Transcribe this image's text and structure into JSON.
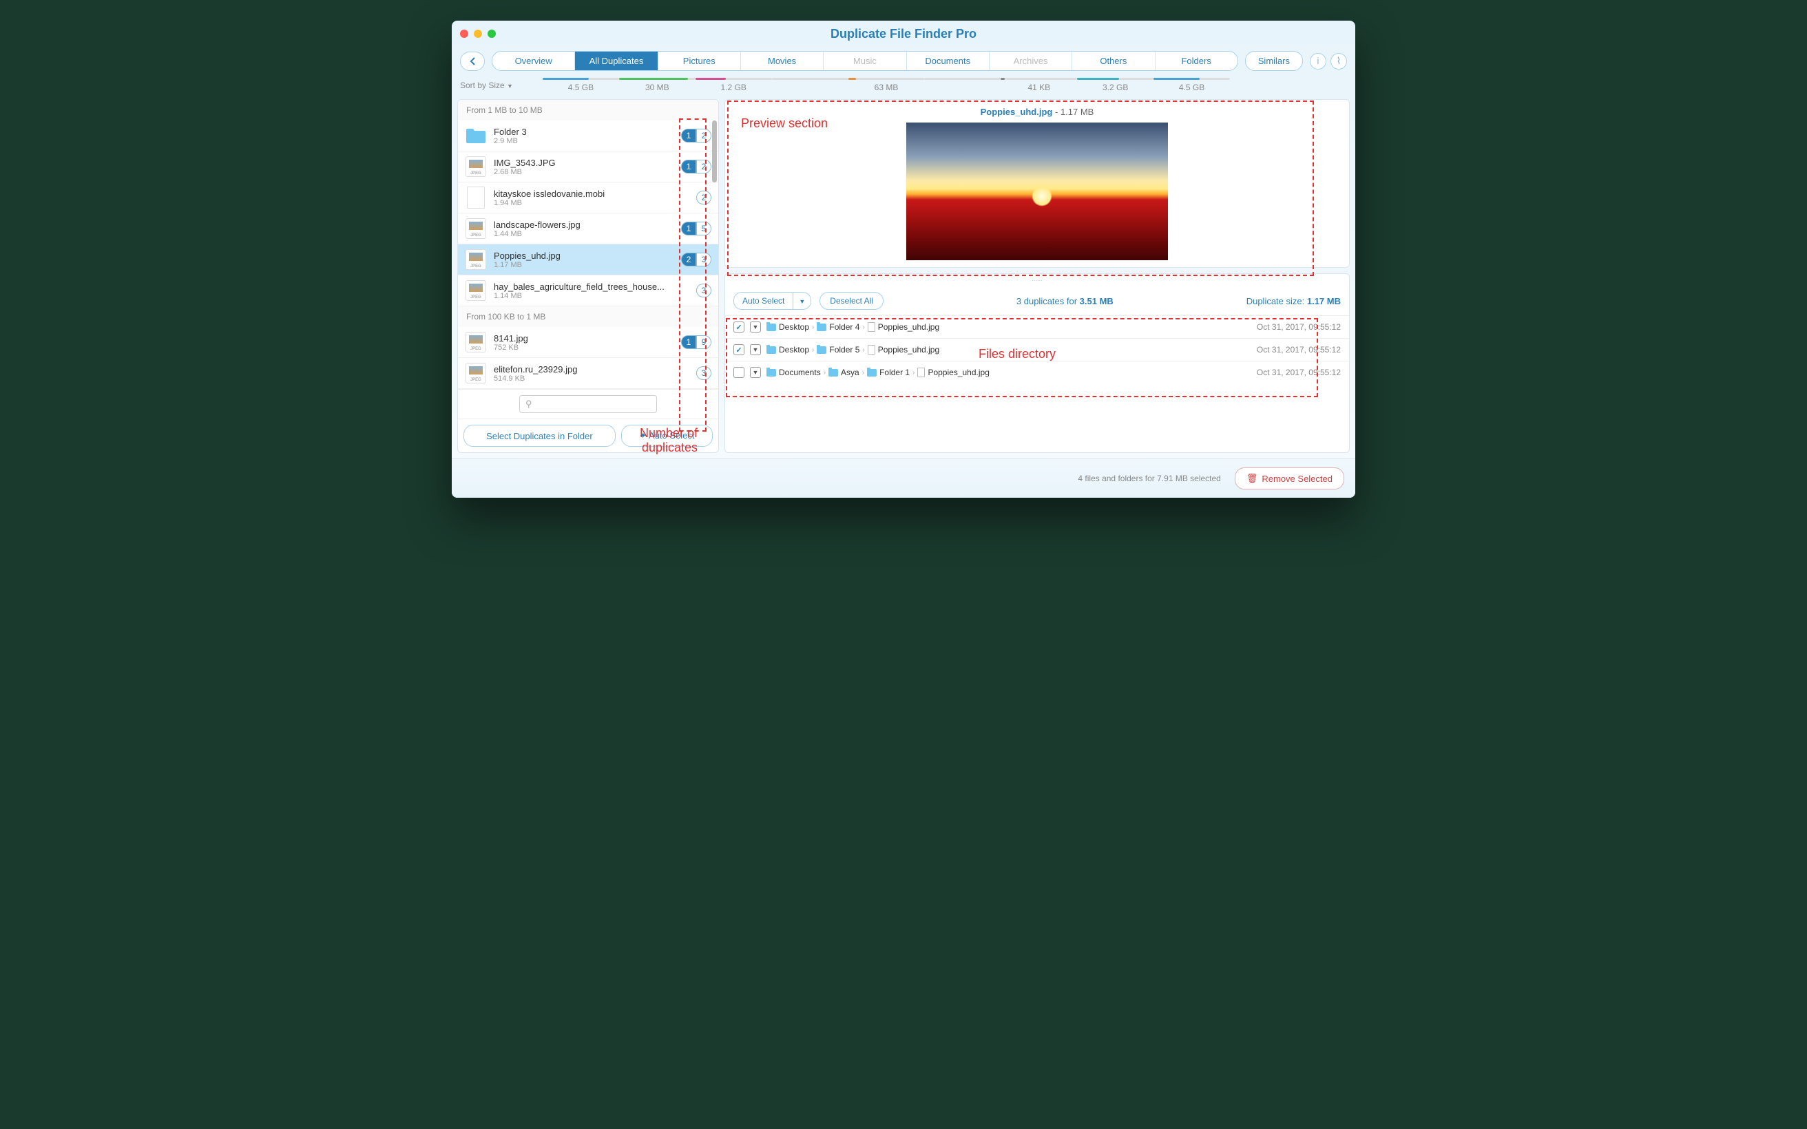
{
  "window": {
    "title": "Duplicate File Finder Pro"
  },
  "toolbar": {
    "tabs": [
      {
        "label": "Overview",
        "active": false
      },
      {
        "label": "All Duplicates",
        "active": true
      },
      {
        "label": "Pictures",
        "active": false
      },
      {
        "label": "Movies",
        "active": false
      },
      {
        "label": "Music",
        "disabled": true
      },
      {
        "label": "Documents",
        "active": false
      },
      {
        "label": "Archives",
        "disabled": true
      },
      {
        "label": "Others",
        "active": false
      },
      {
        "label": "Folders",
        "active": false
      }
    ],
    "similars_label": "Similars"
  },
  "sizebar": {
    "sort_label": "Sort by Size",
    "sizes": [
      "4.5 GB",
      "30 MB",
      "1.2 GB",
      "",
      "63 MB",
      "",
      "41 KB",
      "3.2 GB",
      "4.5 GB"
    ]
  },
  "left": {
    "group1_header": "From 1 MB to 10 MB",
    "group2_header": "From 100 KB to 1 MB",
    "items": [
      {
        "name": "Folder 3",
        "size": "2.9 MB",
        "type": "folder",
        "badges": [
          "1",
          "2"
        ],
        "sel_idx": 0
      },
      {
        "name": "IMG_3543.JPG",
        "size": "2.68 MB",
        "type": "jpeg",
        "badges": [
          "1",
          "2"
        ],
        "sel_idx": 0
      },
      {
        "name": "kitayskoe issledovanie.mobi",
        "size": "1.94 MB",
        "type": "doc",
        "badges": [
          "2"
        ]
      },
      {
        "name": "landscape-flowers.jpg",
        "size": "1.44 MB",
        "type": "jpeg",
        "badges": [
          "1",
          "5"
        ],
        "sel_idx": 0
      },
      {
        "name": "Poppies_uhd.jpg",
        "size": "1.17 MB",
        "type": "jpeg",
        "badges": [
          "2",
          "3"
        ],
        "sel_idx": 0,
        "selected": true
      },
      {
        "name": "hay_bales_agriculture_field_trees_house...",
        "size": "1.14 MB",
        "type": "jpeg",
        "badges": [
          "3"
        ]
      }
    ],
    "items2": [
      {
        "name": "8141.jpg",
        "size": "752 KB",
        "type": "jpeg",
        "badges": [
          "1",
          "9"
        ],
        "sel_idx": 0
      },
      {
        "name": "elitefon.ru_23929.jpg",
        "size": "514.9 KB",
        "type": "jpeg",
        "badges": [
          "3"
        ]
      }
    ],
    "search_placeholder": "",
    "select_in_folder": "Select Duplicates in Folder",
    "auto_select": "Auto Select"
  },
  "preview": {
    "filename": "Poppies_uhd.jpg",
    "filesize": "1.17 MB"
  },
  "details": {
    "auto_select": "Auto Select",
    "deselect_all": "Deselect All",
    "summary_count": "3",
    "summary_size": "3.51 MB",
    "summary_prefix": " duplicates for ",
    "dup_size_label": "Duplicate size: ",
    "dup_size_value": "1.17 MB",
    "paths": [
      {
        "checked": true,
        "crumbs": [
          "Desktop",
          "Folder 4",
          "Poppies_uhd.jpg"
        ],
        "timestamp": "Oct 31, 2017, 09:55:12"
      },
      {
        "checked": true,
        "crumbs": [
          "Desktop",
          "Folder 5",
          "Poppies_uhd.jpg"
        ],
        "timestamp": "Oct 31, 2017, 09:55:12"
      },
      {
        "checked": false,
        "crumbs": [
          "Documents",
          "Asya",
          "Folder 1",
          "Poppies_uhd.jpg"
        ],
        "timestamp": "Oct 31, 2017, 09:55:12"
      }
    ]
  },
  "footer": {
    "status": "4 files and folders for 7.91 MB selected",
    "remove_label": "Remove Selected"
  },
  "annotations": {
    "preview": "Preview section",
    "files_dir": "Files directory",
    "num_dup": "Number of\nduplicates"
  }
}
